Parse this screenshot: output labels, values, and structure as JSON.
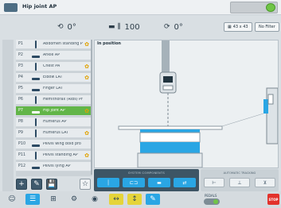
{
  "window": {
    "title": "Hip joint AP"
  },
  "toolbar": {
    "angle1": "0°",
    "sid": "100",
    "angle2": "0°",
    "grid_label": "43 x 43",
    "filter_label": "No Filter"
  },
  "list": {
    "items": [
      {
        "code": "P1",
        "label": "Abdomen standing P",
        "pose": "stand",
        "star": true
      },
      {
        "code": "P2",
        "label": "Ankle AP",
        "pose": "lie",
        "star": false
      },
      {
        "code": "P3",
        "label": "Chest PA",
        "pose": "stand",
        "star": true
      },
      {
        "code": "P4",
        "label": "Elbow LAT",
        "pose": "lie",
        "star": true
      },
      {
        "code": "P5",
        "label": "Finger LAT",
        "pose": "lie",
        "star": false
      },
      {
        "code": "P6",
        "label": "Hemithorax (Ribs) Pr",
        "pose": "stand",
        "star": false
      },
      {
        "code": "P7",
        "label": "Hip joint AP",
        "pose": "lie",
        "star": true,
        "selected": true
      },
      {
        "code": "P8",
        "label": "Humerus AP",
        "pose": "stand",
        "star": false
      },
      {
        "code": "P9",
        "label": "Humerus LAT",
        "pose": "stand",
        "star": true
      },
      {
        "code": "P10",
        "label": "Pelvis wing bold pro",
        "pose": "lie",
        "star": false
      },
      {
        "code": "P11",
        "label": "Pelvis standing AP",
        "pose": "stand",
        "star": true
      },
      {
        "code": "P12",
        "label": "Pelvis lying AP",
        "pose": "lie",
        "star": false
      }
    ]
  },
  "list_actions": {
    "add": "+",
    "edit": "✎",
    "save": "💾",
    "star": "☆"
  },
  "canvas": {
    "label": "In position"
  },
  "system_components": {
    "title": "SYSTEM COMPONENTS",
    "buttons": [
      "│",
      "⊏⊐",
      "▬",
      "⇄"
    ]
  },
  "automatic_tracking": {
    "title": "AUTOMATIC TRACKING",
    "buttons": [
      "⊢",
      "⊥",
      "⊻"
    ]
  },
  "bottom": {
    "pedals_label": "PEDALS",
    "stop_label": "STOP"
  },
  "colors": {
    "accent": "#2aa6e4",
    "selected": "#62b548",
    "stop": "#e2322c"
  }
}
